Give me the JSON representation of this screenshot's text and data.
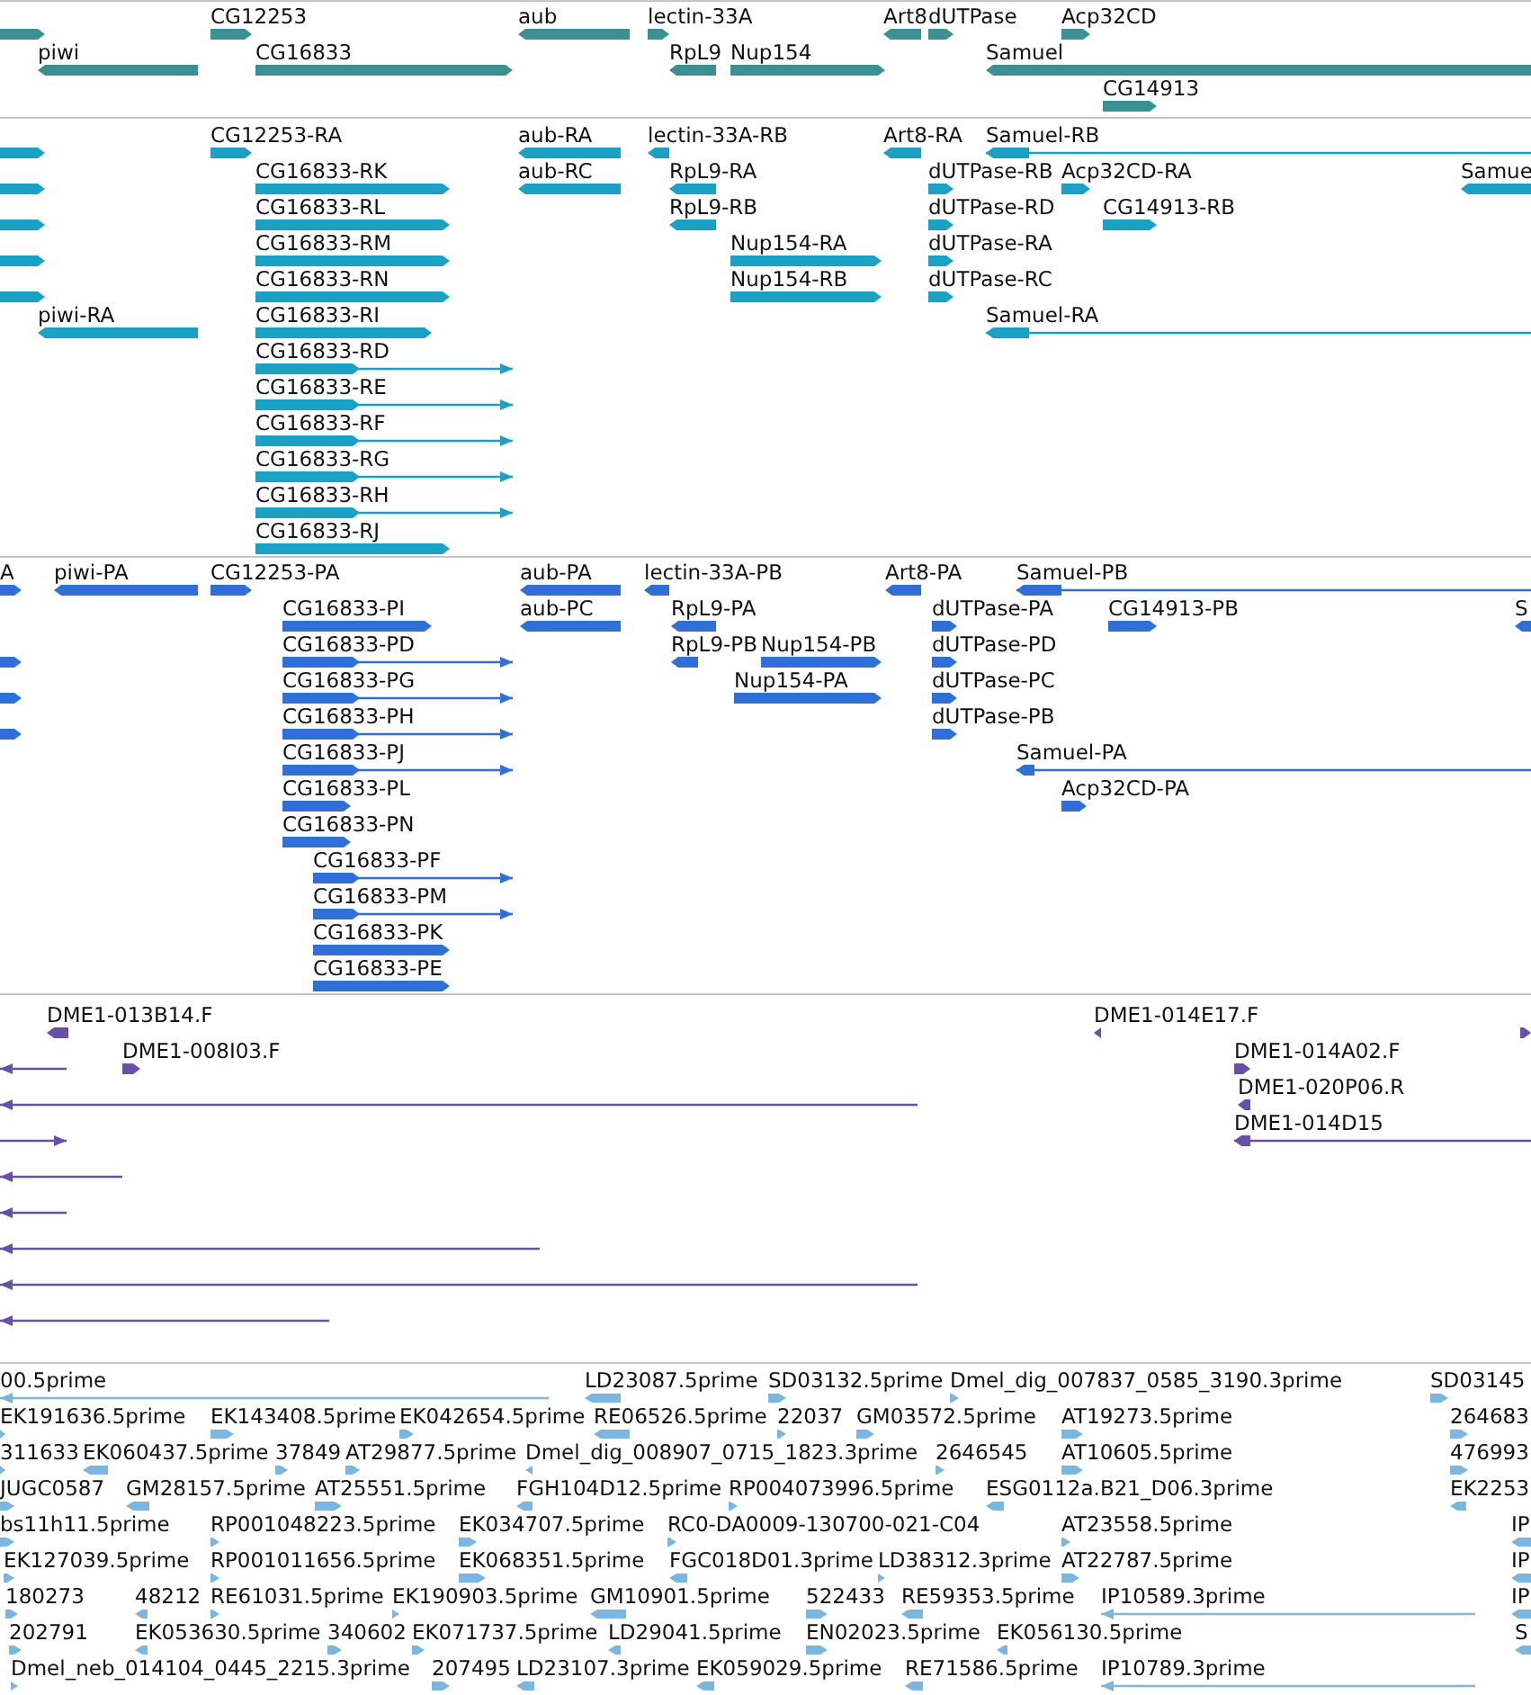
{
  "tracks": [
    {
      "color": "#3a9092",
      "features": [
        {
          "reverse": false
        },
        {
          "label": "CG12253",
          "reverse": false
        },
        {
          "label": "aub",
          "reverse": true
        },
        {
          "label": "lectin-33A",
          "reverse": false
        },
        {
          "label": "Art8",
          "reverse": true
        },
        {
          "label": "dUTPase",
          "reverse": false
        },
        {
          "label": "Acp32CD",
          "reverse": false
        },
        {
          "label": "piwi",
          "reverse": true
        },
        {
          "label": "CG16833",
          "reverse": false
        },
        {
          "label": "RpL9",
          "reverse": true
        },
        {
          "label": "Nup154",
          "reverse": false
        },
        {
          "label": "Samuel",
          "reverse": true
        },
        {
          "label": "CG14913",
          "reverse": false
        }
      ]
    },
    {
      "color": "#1ca0c4",
      "features": [
        {
          "reverse": false
        },
        {
          "label": "CG12253-RA",
          "reverse": false
        },
        {
          "label": "aub-RA",
          "reverse": true
        },
        {
          "label": "lectin-33A-RB",
          "reverse": true
        },
        {
          "label": "Art8-RA",
          "reverse": true
        },
        {
          "label": "Samuel-RB",
          "reverse": true
        },
        {
          "reverse": false
        },
        {
          "label": "CG16833-RK",
          "reverse": false
        },
        {
          "label": "aub-RC",
          "reverse": true
        },
        {
          "label": "RpL9-RA",
          "reverse": true
        },
        {
          "label": "dUTPase-RB",
          "reverse": false
        },
        {
          "label": "Acp32CD-RA",
          "reverse": false
        },
        {
          "label": "Samue",
          "reverse": true
        },
        {
          "reverse": false
        },
        {
          "label": "CG16833-RL",
          "reverse": false
        },
        {
          "label": "RpL9-RB",
          "reverse": true
        },
        {
          "label": "dUTPase-RD",
          "reverse": false
        },
        {
          "label": "CG14913-RB",
          "reverse": false
        },
        {
          "reverse": false
        },
        {
          "label": "CG16833-RM",
          "reverse": false
        },
        {
          "label": "Nup154-RA",
          "reverse": false
        },
        {
          "label": "dUTPase-RA",
          "reverse": false
        },
        {
          "reverse": false
        },
        {
          "label": "CG16833-RN",
          "reverse": false
        },
        {
          "label": "Nup154-RB",
          "reverse": false
        },
        {
          "label": "dUTPase-RC",
          "reverse": false
        },
        {
          "label": "piwi-RA",
          "reverse": true
        },
        {
          "label": "CG16833-RI",
          "reverse": false
        },
        {
          "label": "Samuel-RA",
          "reverse": true
        },
        {
          "label": "CG16833-RD",
          "reverse": false
        },
        {
          "label": "CG16833-RE",
          "reverse": false
        },
        {
          "label": "CG16833-RF",
          "reverse": false
        },
        {
          "label": "CG16833-RG",
          "reverse": false
        },
        {
          "label": "CG16833-RH",
          "reverse": false
        },
        {
          "label": "CG16833-RJ",
          "reverse": false
        }
      ]
    },
    {
      "color": "#2f6fd6",
      "features": [
        {
          "label": "A",
          "reverse": false
        },
        {
          "label": "piwi-PA",
          "reverse": true
        },
        {
          "label": "CG12253-PA",
          "reverse": false
        },
        {
          "label": "aub-PA",
          "reverse": true
        },
        {
          "label": "lectin-33A-PB",
          "reverse": true
        },
        {
          "label": "Art8-PA",
          "reverse": true
        },
        {
          "label": "Samuel-PB",
          "reverse": true
        },
        {
          "label": "CG16833-PI",
          "reverse": false
        },
        {
          "label": "aub-PC",
          "reverse": true
        },
        {
          "label": "RpL9-PA",
          "reverse": true
        },
        {
          "label": "dUTPase-PA",
          "reverse": false
        },
        {
          "label": "CG14913-PB",
          "reverse": false
        },
        {
          "label": "S",
          "reverse": true
        },
        {
          "reverse": false
        },
        {
          "label": "CG16833-PD",
          "reverse": false
        },
        {
          "label": "RpL9-PB",
          "reverse": true
        },
        {
          "label": "Nup154-PB",
          "reverse": false
        },
        {
          "label": "dUTPase-PD",
          "reverse": false
        },
        {
          "reverse": false
        },
        {
          "label": "CG16833-PG",
          "reverse": false
        },
        {
          "label": "Nup154-PA",
          "reverse": false
        },
        {
          "label": "dUTPase-PC",
          "reverse": false
        },
        {
          "reverse": false
        },
        {
          "label": "CG16833-PH",
          "reverse": false
        },
        {
          "label": "dUTPase-PB",
          "reverse": false
        },
        {
          "label": "CG16833-PJ",
          "reverse": false
        },
        {
          "label": "Samuel-PA",
          "reverse": true
        },
        {
          "label": "CG16833-PL",
          "reverse": false
        },
        {
          "label": "Acp32CD-PA",
          "reverse": false
        },
        {
          "label": "CG16833-PN",
          "reverse": false
        },
        {
          "label": "CG16833-PF",
          "reverse": false
        },
        {
          "label": "CG16833-PM",
          "reverse": false
        },
        {
          "label": "CG16833-PK",
          "reverse": false
        },
        {
          "label": "CG16833-PE",
          "reverse": false
        }
      ]
    },
    {
      "color": "#6a4fa8",
      "features": [
        {
          "label": "DME1-013B14.F",
          "reverse": true
        },
        {
          "label": "DME1-014E17.F",
          "reverse": true
        },
        {
          "reverse": false
        },
        {
          "reverse": true
        },
        {
          "label": "DME1-008I03.F",
          "reverse": false
        },
        {
          "label": "DME1-014A02.F",
          "reverse": false
        },
        {
          "reverse": true
        },
        {
          "label": "DME1-020P06.R",
          "reverse": true
        },
        {
          "reverse": false
        },
        {
          "label": "DME1-014D15",
          "reverse": true
        },
        {
          "reverse": true
        },
        {
          "reverse": true
        },
        {
          "reverse": true
        },
        {
          "reverse": true
        },
        {
          "reverse": true
        }
      ]
    },
    {
      "color": "#7ab6e0",
      "features": [
        {
          "label": "00.5prime",
          "reverse": true
        },
        {
          "label": "LD23087.5prime",
          "reverse": true
        },
        {
          "label": "SD03132.5prime",
          "reverse": false
        },
        {
          "label": "Dmel_dig_007837_0585_3190.3prime",
          "reverse": false
        },
        {
          "label": "SD03145",
          "reverse": false
        },
        {
          "label": "EK191636.5prime",
          "reverse": false
        },
        {
          "label": "EK143408.5prime",
          "reverse": false
        },
        {
          "label": "EK042654.5prime",
          "reverse": false
        },
        {
          "label": "RE06526.5prime",
          "reverse": true
        },
        {
          "label": "22037",
          "reverse": false
        },
        {
          "label": "GM03572.5prime",
          "reverse": false
        },
        {
          "label": "AT19273.5prime",
          "reverse": false
        },
        {
          "label": "264683",
          "reverse": false
        },
        {
          "label": "311633",
          "reverse": false
        },
        {
          "label": "EK060437.5prime",
          "reverse": true
        },
        {
          "label": "37849",
          "reverse": false
        },
        {
          "label": "AT29877.5prime",
          "reverse": false
        },
        {
          "label": "Dmel_dig_008907_0715_1823.3prime",
          "reverse": true
        },
        {
          "label": "2646545",
          "reverse": false
        },
        {
          "label": "AT10605.5prime",
          "reverse": false
        },
        {
          "label": "476993",
          "reverse": false
        },
        {
          "label": "JUGC0587",
          "reverse": false
        },
        {
          "label": "GM28157.5prime",
          "reverse": true
        },
        {
          "label": "AT25551.5prime",
          "reverse": false
        },
        {
          "label": "FGH104D12.5prime",
          "reverse": true
        },
        {
          "label": "RP004073996.5prime",
          "reverse": false
        },
        {
          "label": "ESG0112a.B21_D06.3prime",
          "reverse": true
        },
        {
          "label": "EK2253",
          "reverse": true
        },
        {
          "label": "bs11h11.5prime",
          "reverse": false
        },
        {
          "label": "RP001048223.5prime",
          "reverse": false
        },
        {
          "label": "EK034707.5prime",
          "reverse": false
        },
        {
          "label": "RC0-DA0009-130700-021-C04",
          "reverse": false
        },
        {
          "label": "AT23558.5prime",
          "reverse": false
        },
        {
          "label": "IP",
          "reverse": true
        },
        {
          "label": "EK127039.5prime",
          "reverse": false
        },
        {
          "label": "RP001011656.5prime",
          "reverse": false
        },
        {
          "label": "EK068351.5prime",
          "reverse": false
        },
        {
          "label": "FGC018D01.3prime",
          "reverse": true
        },
        {
          "label": "LD38312.3prime",
          "reverse": false
        },
        {
          "label": "AT22787.5prime",
          "reverse": false
        },
        {
          "label": "IP",
          "reverse": true
        },
        {
          "label": "180273",
          "reverse": false
        },
        {
          "label": "48212",
          "reverse": true
        },
        {
          "label": "RE61031.5prime",
          "reverse": false
        },
        {
          "label": "EK190903.5prime",
          "reverse": false
        },
        {
          "label": "GM10901.5prime",
          "reverse": true
        },
        {
          "label": "522433",
          "reverse": false
        },
        {
          "label": "RE59353.5prime",
          "reverse": true
        },
        {
          "label": "IP10589.3prime",
          "reverse": true
        },
        {
          "label": "IP",
          "reverse": true
        },
        {
          "label": "202791",
          "reverse": false
        },
        {
          "label": "EK053630.5prime",
          "reverse": true
        },
        {
          "label": "340602",
          "reverse": false
        },
        {
          "label": "EK071737.5prime",
          "reverse": false
        },
        {
          "label": "LD29041.5prime",
          "reverse": true
        },
        {
          "label": "EN02023.5prime",
          "reverse": false
        },
        {
          "label": "EK056130.5prime",
          "reverse": true
        },
        {
          "label": "S",
          "reverse": true
        },
        {
          "label": "Dmel_neb_014104_0445_2215.3prime",
          "reverse": false
        },
        {
          "label": "207495",
          "reverse": false
        },
        {
          "label": "LD23107.3prime",
          "reverse": true
        },
        {
          "label": "EK059029.5prime",
          "reverse": true
        },
        {
          "label": "RE71586.5prime",
          "reverse": true
        },
        {
          "label": "IP10789.3prime",
          "reverse": true
        }
      ]
    }
  ]
}
